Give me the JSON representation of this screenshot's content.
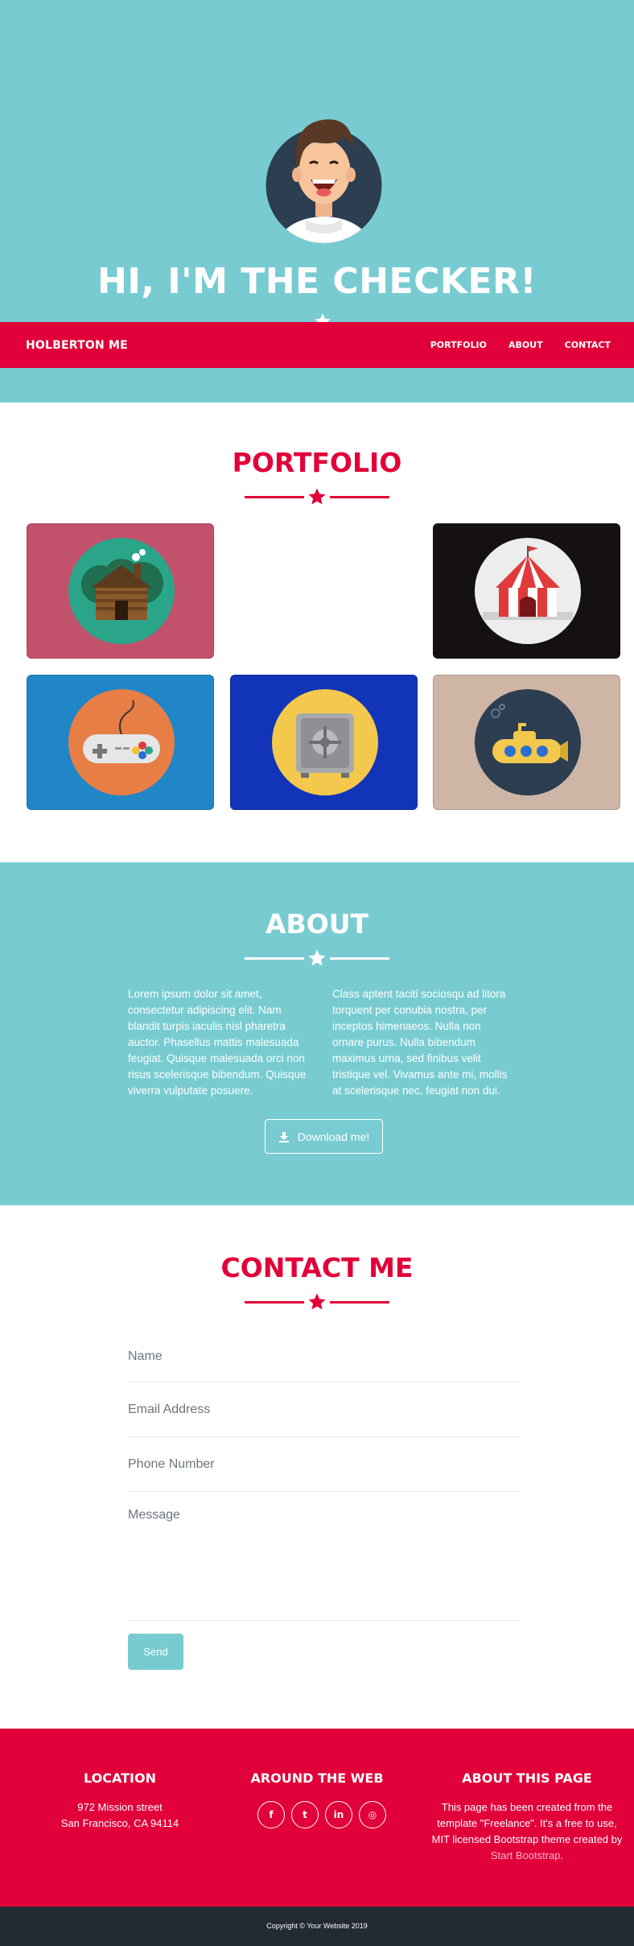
{
  "colors": {
    "teal": "#78ccd1",
    "red": "#e10039",
    "dark": "#222a33"
  },
  "masthead": {
    "title": "HI, I'M THE CHECKER!"
  },
  "navbar": {
    "brand": "HOLBERTON ME",
    "links": [
      "PORTFOLIO",
      "ABOUT",
      "CONTACT"
    ]
  },
  "portfolio": {
    "title": "PORTFOLIO",
    "items": [
      {
        "icon": "cabin-icon",
        "bg": "#c2516b"
      },
      {
        "icon": "circus-tent-icon",
        "bg": "#161111"
      },
      {
        "icon": "game-controller-icon",
        "bg": "#2086c8"
      },
      {
        "icon": "safe-icon",
        "bg": "#1134b8"
      },
      {
        "icon": "submarine-icon",
        "bg": "#ceb5a6"
      }
    ]
  },
  "about": {
    "title": "ABOUT",
    "left_text": "Lorem ipsum dolor sit amet, consectetur adipiscing elit. Nam blandit turpis iaculis nisl pharetra auctor. Phasellus mattis malesuada feugiat. Quisque malesuada orci non risus scelerisque bibendum. Quisque viverra vulputate posuere.",
    "right_text": "Class aptent taciti sociosqu ad litora torquent per conubia nostra, per inceptos himenaeos. Nulla non ornare purus. Nulla bibendum maximus urna, sed finibus velit tristique vel. Vivamus ante mi, mollis at scelerisque nec, feugiat non dui.",
    "download_label": "Download me!"
  },
  "contact": {
    "title": "CONTACT ME",
    "name_placeholder": "Name",
    "email_placeholder": "Email Address",
    "phone_placeholder": "Phone Number",
    "message_placeholder": "Message",
    "send_label": "Send"
  },
  "footer": {
    "location_title": "LOCATION",
    "address_line1": "972 Mission street",
    "address_line2": "San Francisco, CA 94114",
    "web_title": "AROUND THE WEB",
    "social": [
      {
        "icon": "facebook-icon",
        "glyph": "f"
      },
      {
        "icon": "twitter-icon",
        "glyph": "t"
      },
      {
        "icon": "linkedin-icon",
        "glyph": "in"
      },
      {
        "icon": "dribbble-icon",
        "glyph": "◎"
      }
    ],
    "about_title": "ABOUT THIS PAGE",
    "about_text_before": "This page has been created from the template \"Freelance\". It's a free to use, MIT licensed Bootstrap theme created by ",
    "about_link": "Start Bootstrap",
    "about_text_after": ".",
    "copyright": "Copyright © Your Website 2019"
  }
}
